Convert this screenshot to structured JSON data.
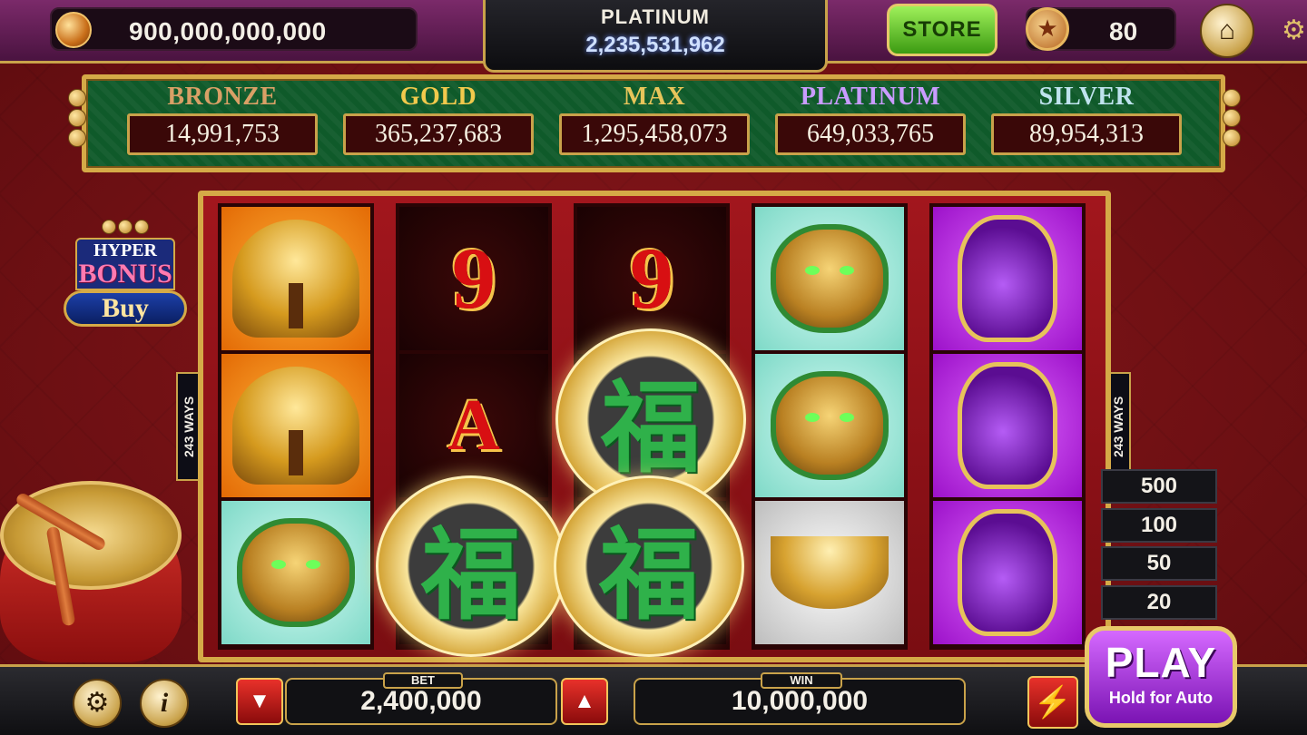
{
  "topbar": {
    "coins": "900,000,000,000",
    "tier_name": "PLATINUM",
    "tier_points": "2,235,531,962",
    "store_label": "STORE",
    "level": "80",
    "icons": {
      "coin": "coin-icon",
      "level": "star-medal-icon",
      "home": "home-icon",
      "settings": "gear-icon"
    }
  },
  "jackpots": [
    {
      "label": "BRONZE",
      "value": "14,991,753",
      "color": "#d9a066"
    },
    {
      "label": "GOLD",
      "value": "365,237,683",
      "color": "#f2c94c"
    },
    {
      "label": "MAX",
      "value": "1,295,458,073",
      "color": "#e8c55a"
    },
    {
      "label": "PLATINUM",
      "value": "649,033,765",
      "color": "#c99cff"
    },
    {
      "label": "SILVER",
      "value": "89,954,313",
      "color": "#bfe3ee"
    }
  ],
  "bonus_buy": {
    "line1": "HYPER",
    "line2": "BONUS",
    "button": "Buy"
  },
  "ways_label": "243 WAYS",
  "reels": [
    [
      "money-tree",
      "money-tree",
      "fu-lion"
    ],
    [
      "9",
      "A",
      "fu-coin"
    ],
    [
      "9",
      "fu-coin",
      "fu-coin"
    ],
    [
      "fu-lion",
      "fu-lion",
      "gold-ingot"
    ],
    [
      "purple-vase",
      "purple-vase",
      "purple-vase"
    ]
  ],
  "coin_symbol_glyph": "福",
  "quick_bets": [
    "500",
    "100",
    "50",
    "20"
  ],
  "bottom": {
    "bet_label": "BET",
    "bet_value": "2,400,000",
    "win_label": "WIN",
    "win_value": "10,000,000",
    "play_label": "PLAY",
    "play_sub": "Hold for Auto",
    "icons": {
      "settings": "gear-icon",
      "info": "info-icon",
      "decrease": "arrow-down-icon",
      "increase": "arrow-up-icon",
      "turbo": "lightning-icon"
    }
  }
}
